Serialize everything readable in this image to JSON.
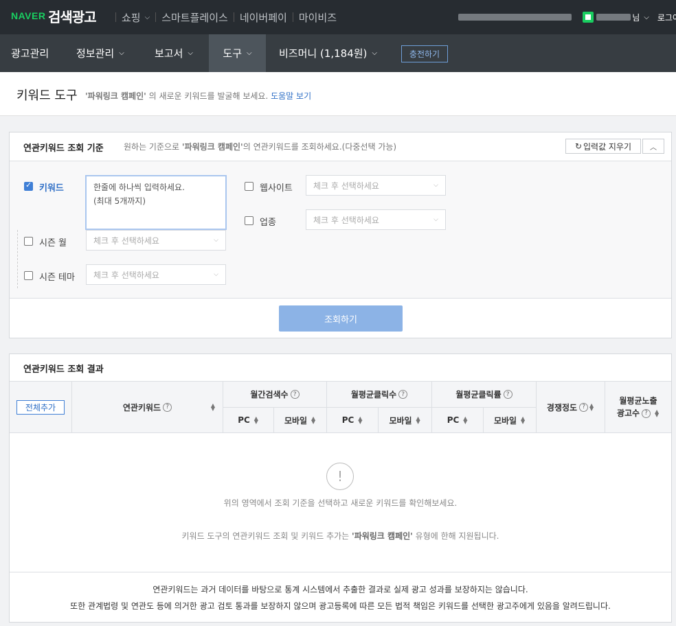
{
  "topbar": {
    "naver_logo": "NAVER",
    "brand": "검색광고",
    "gnb": [
      "쇼핑",
      "스마트플레이스",
      "네이버페이",
      "마이비즈"
    ],
    "user_suffix": "님",
    "logout": "로그아"
  },
  "menu": {
    "items": [
      "광고관리",
      "정보관리",
      "보고서",
      "도구",
      "비즈머니 (1,184원)"
    ],
    "active": "도구",
    "charge": "충전하기"
  },
  "page": {
    "title": "키워드 도구",
    "desc_campaign": "'파워링크 캠페인'",
    "desc_text": " 의 새로운 키워드를 발굴해 보세요.",
    "help_link": "도움말 보기"
  },
  "criteria": {
    "title": "연관키워드 조회 기준",
    "desc_prefix": "원하는 기준으로 ",
    "desc_campaign": "'파워링크 캠페인'",
    "desc_suffix": "의 연관키워드를 조회하세요.(다중선택 가능)",
    "clear_label": "입력값 지우기",
    "keyword_label": "키워드",
    "keyword_placeholder_line1": "한줄에 하나씩 입력하세요.",
    "keyword_placeholder_line2": "(최대 5개까지)",
    "website_label": "웹사이트",
    "industry_label": "업종",
    "season_month_label": "시즌 월",
    "season_theme_label": "시즌 테마",
    "select_placeholder": "체크 후 선택하세요",
    "search_button": "조회하기",
    "keyword_checked": true
  },
  "results": {
    "title": "연관키워드 조회 결과",
    "add_all": "전체추가",
    "columns": {
      "keyword": "연관키워드",
      "monthly_search": "월간검색수",
      "monthly_clicks": "월평균클릭수",
      "monthly_ctr": "월평균클릭률",
      "competition": "경쟁정도",
      "ad_count_line1": "월평균노출",
      "ad_count_line2": "광고수",
      "pc": "PC",
      "mobile": "모바일"
    },
    "empty_icon": "!",
    "empty_line1": "위의 영역에서 조회 기준을 선택하고 새로운 키워드를 확인해보세요.",
    "empty_line2_prefix": "키워드 도구의 연관키워드 조회 및 키워드 추가는 ",
    "empty_line2_campaign": "'파워링크 캠페인'",
    "empty_line2_suffix": " 유형에 한해 지원됩니다.",
    "footnote1": "연관키워드는 과거 데이터를 바탕으로 통계 시스템에서 추출한 결과로 실제 광고 성과를 보장하지는 않습니다.",
    "footnote2": "또한 관계법령 및 연관도 등에 의거한 광고 검토 통과를 보장하지 않으며 광고등록에 따른 모든 법적 책임은 키워드를 선택한 광고주에게 있음을 알려드립니다."
  },
  "colors": {
    "naver_green": "#19ce60",
    "accent_blue": "#2f6fc6",
    "topbar_bg": "#272c31",
    "menubar_bg": "#373d42",
    "active_menu_bg": "#4d555c",
    "search_button_bg": "#8cb3e6"
  },
  "icons": [
    "chevron-down-icon",
    "refresh-icon",
    "chevron-up-icon",
    "help-circle-icon",
    "sort-icon",
    "alert-circle-icon",
    "checkbox-icon"
  ]
}
